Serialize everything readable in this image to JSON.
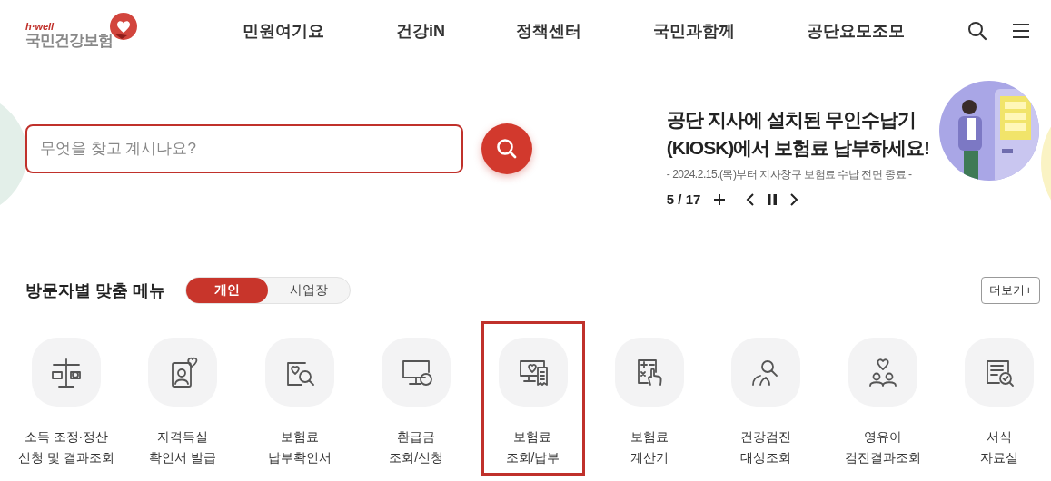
{
  "header": {
    "logo": {
      "tagline": "h·well",
      "name": "국민건강보험"
    },
    "nav": [
      {
        "label": "민원여기요"
      },
      {
        "label": "건강iN"
      },
      {
        "label": "정책센터"
      },
      {
        "label": "국민과함께"
      },
      {
        "label": "공단요모조모"
      }
    ]
  },
  "search": {
    "placeholder": "무엇을 찾고 계시나요?"
  },
  "banner": {
    "title_lines": [
      "공단 지사에 설치된 무인수납기",
      "(KIOSK)에서 보험료 납부하세요!"
    ],
    "subtitle": "- 2024.2.15.(목)부터 지사창구 보험료 수납 전면 종료 -",
    "counter": "5 / 17",
    "kind": "picture"
  },
  "menu": {
    "title": "방문자별 맞춤 메뉴",
    "tabs": [
      {
        "label": "개인",
        "selected": true
      },
      {
        "label": "사업장",
        "selected": false
      }
    ],
    "more": "더보기+",
    "items": [
      {
        "lines": [
          "소득 조정·정산",
          "신청 및 결과조회"
        ],
        "highlighted": false
      },
      {
        "lines": [
          "자격득실",
          "확인서 발급"
        ],
        "highlighted": false
      },
      {
        "lines": [
          "보험료",
          "납부확인서"
        ],
        "highlighted": false
      },
      {
        "lines": [
          "환급금",
          "조회/신청"
        ],
        "highlighted": false
      },
      {
        "lines": [
          "보험료",
          "조회/납부"
        ],
        "highlighted": true
      },
      {
        "lines": [
          "보험료",
          "계산기"
        ],
        "highlighted": false
      },
      {
        "lines": [
          "건강검진",
          "대상조회"
        ],
        "highlighted": false
      },
      {
        "lines": [
          "영유아",
          "검진결과조회"
        ],
        "highlighted": false
      },
      {
        "lines": [
          "서식",
          "자료실"
        ],
        "highlighted": false
      }
    ]
  }
}
